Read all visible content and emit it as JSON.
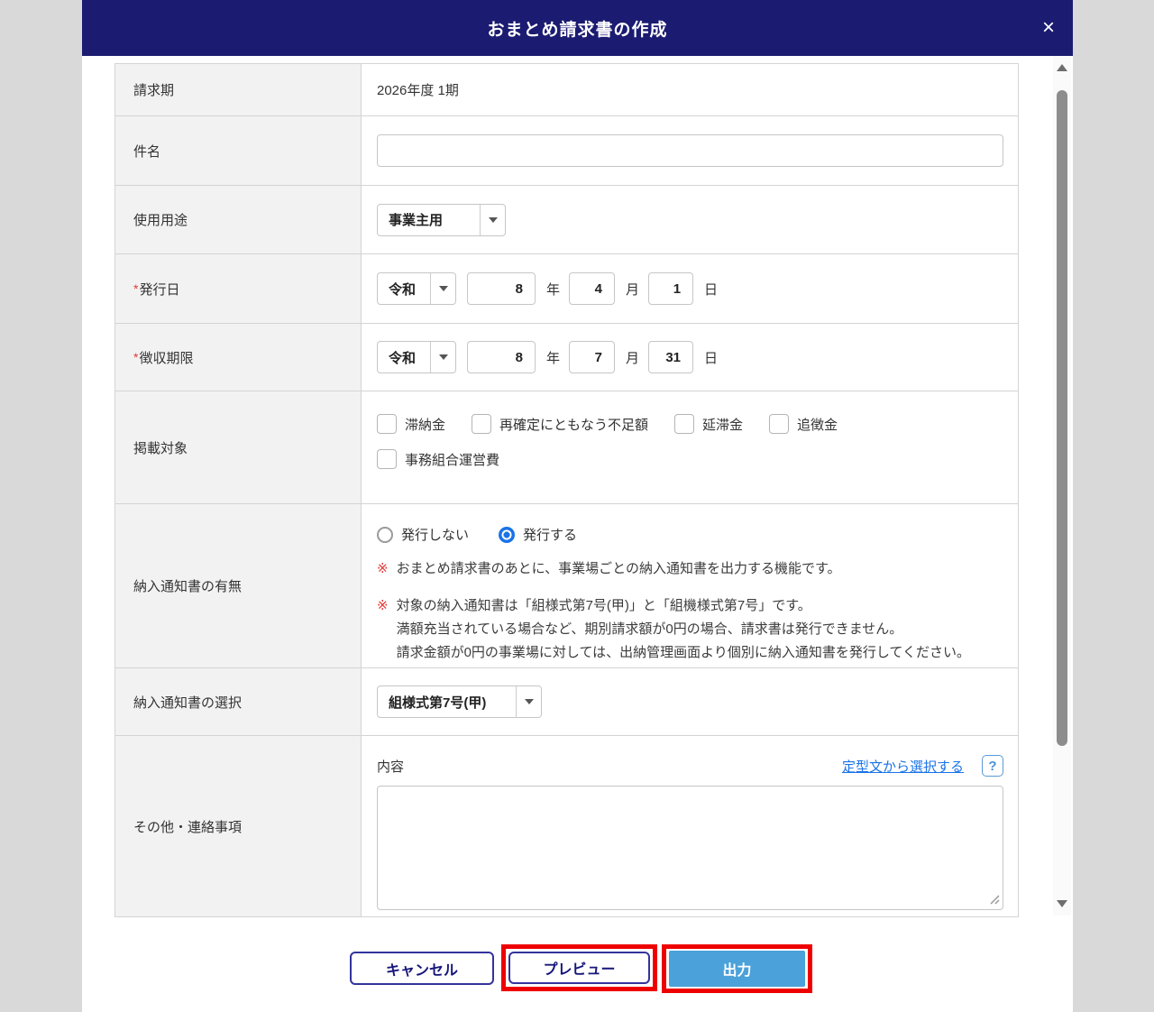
{
  "modal": {
    "title": "おまとめ請求書の作成",
    "close_icon": "×"
  },
  "form": {
    "billing_period": {
      "label": "請求期",
      "value": "2026年度 1期"
    },
    "subject": {
      "label": "件名",
      "value": ""
    },
    "usage": {
      "label": "使用用途",
      "selected": "事業主用"
    },
    "issue_date": {
      "label": "発行日",
      "required_mark": "*",
      "era": "令和",
      "year": "8",
      "month": "4",
      "day": "1",
      "year_unit": "年",
      "month_unit": "月",
      "day_unit": "日"
    },
    "due_date": {
      "label": "徴収期限",
      "required_mark": "*",
      "era": "令和",
      "year": "8",
      "month": "7",
      "day": "31",
      "year_unit": "年",
      "month_unit": "月",
      "day_unit": "日"
    },
    "target": {
      "label": "掲載対象",
      "items": [
        "滞納金",
        "再確定にともなう不足額",
        "延滞金",
        "追徴金",
        "事務組合運営費"
      ]
    },
    "delivery_notice": {
      "label": "納入通知書の有無",
      "options": [
        {
          "label": "発行しない",
          "selected": false
        },
        {
          "label": "発行する",
          "selected": true
        }
      ],
      "note_mark": "※",
      "note1": "おまとめ請求書のあとに、事業場ごとの納入通知書を出力する機能です。",
      "note2_line1": "対象の納入通知書は「組様式第7号(甲)」と「組機様式第7号」です。",
      "note2_line2": "満額充当されている場合など、期別請求額が0円の場合、請求書は発行できません。",
      "note2_line3": "請求金額が0円の事業場に対しては、出納管理画面より個別に納入通知書を発行してください。"
    },
    "notice_form": {
      "label": "納入通知書の選択",
      "selected": "組様式第7号(甲)"
    },
    "remarks": {
      "label": "その他・連絡事項",
      "content_label": "内容",
      "template_link": "定型文から選択する",
      "help_icon": "?",
      "textarea_value": ""
    }
  },
  "footer": {
    "cancel": "キャンセル",
    "preview": "プレビュー",
    "output": "出力"
  },
  "colors": {
    "header_bg": "#1b1b71",
    "accent_blue": "#1a73e8",
    "output_button_bg": "#4ba1da",
    "highlight_red": "#ee0000",
    "required_red": "#e53935"
  }
}
